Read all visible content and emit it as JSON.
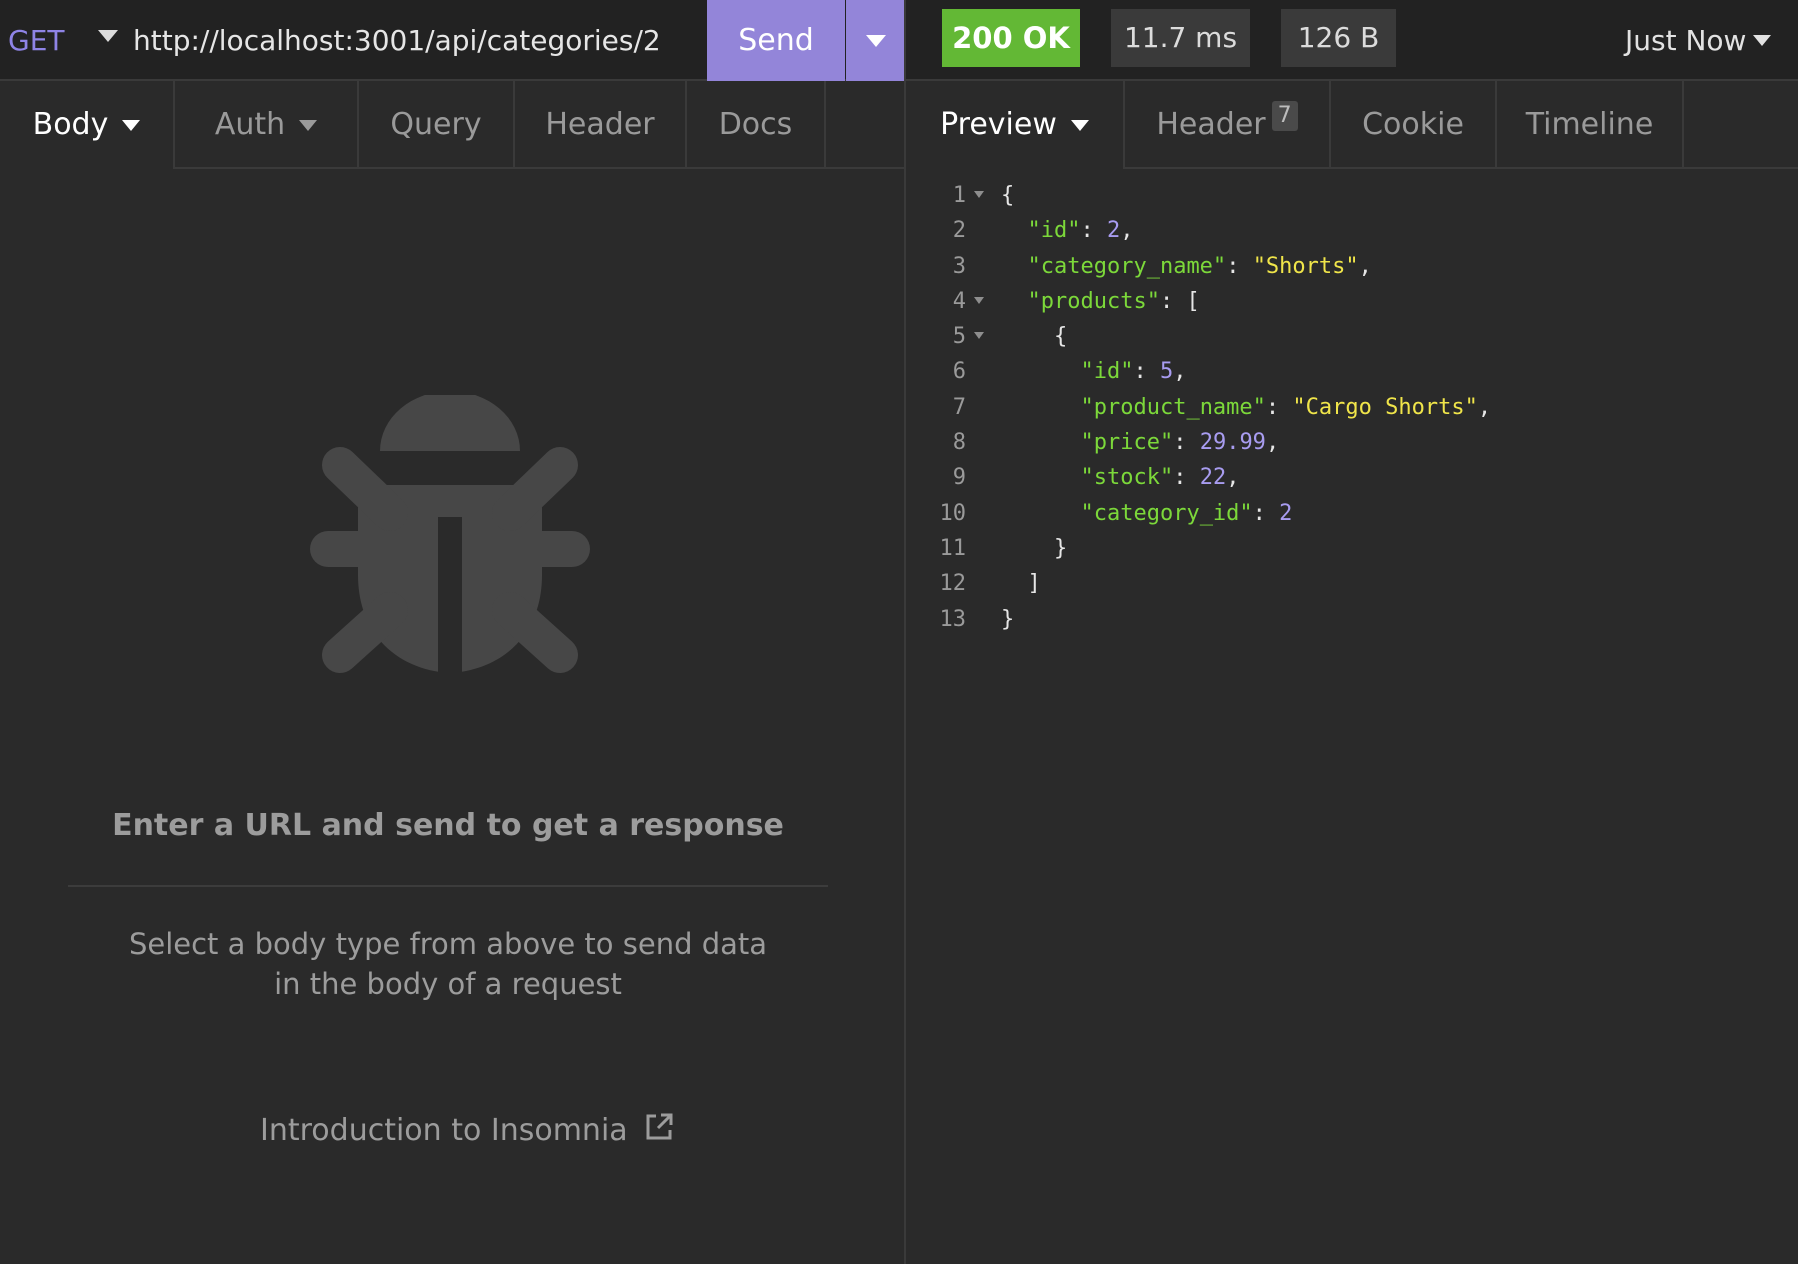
{
  "request": {
    "method": "GET",
    "url": "http://localhost:3001/api/categories/2",
    "send_label": "Send"
  },
  "response": {
    "status": "200 OK",
    "timing": "11.7 ms",
    "size": "126 B",
    "time_ago": "Just Now"
  },
  "request_tabs": [
    "Body",
    "Auth",
    "Query",
    "Header",
    "Docs"
  ],
  "response_tabs": [
    "Preview",
    "Header",
    "Cookie",
    "Timeline"
  ],
  "response_header_count": "7",
  "empty_state": {
    "title": "Enter a URL and send to get a response",
    "hint": "Select a body type from above to send data in the body of a request",
    "link": "Introduction to Insomnia"
  },
  "json_tokens": {
    "l1_open": "{",
    "l2_key": "\"id\"",
    "l2_val": "2",
    "l3_key": "\"category_name\"",
    "l3_val": "\"Shorts\"",
    "l4_key": "\"products\"",
    "l4_open": "[",
    "l5_open": "{",
    "l6_key": "\"id\"",
    "l6_val": "5",
    "l7_key": "\"product_name\"",
    "l7_val": "\"Cargo Shorts\"",
    "l8_key": "\"price\"",
    "l8_val": "29.99",
    "l9_key": "\"stock\"",
    "l9_val": "22",
    "l10_key": "\"category_id\"",
    "l10_val": "2",
    "l11_close": "}",
    "l12_close": "]",
    "l13_close": "}"
  },
  "colors": {
    "send_button": "#9385d9",
    "status_ok": "#63b835",
    "json_key": "#7cd83a",
    "json_string": "#f0e54a",
    "json_number": "#a89cf0"
  },
  "icons": [
    "chevron-down-icon",
    "bug-icon",
    "external-link-icon",
    "fold-arrow-icon"
  ]
}
